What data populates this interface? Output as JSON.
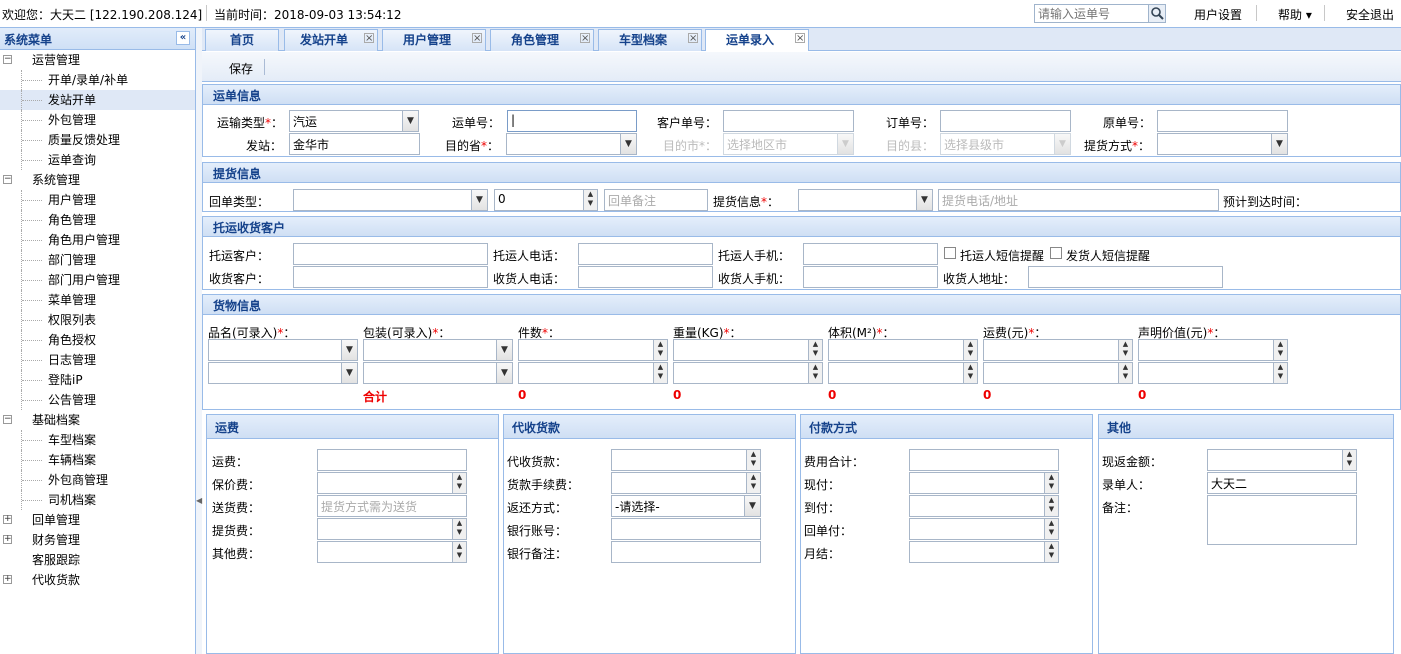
{
  "topbar": {
    "welcome": "欢迎您：大天二 [122.190.208.124]",
    "time": "当前时间：2018-09-03 13:54:12",
    "search_placeholder": "请输入运单号",
    "user_settings": "用户设置",
    "help": "帮助 ▾",
    "logout": "安全退出"
  },
  "sidebar": {
    "title": "系统菜单",
    "collapse_icon": "«",
    "items": [
      {
        "label": "运营管理",
        "level": 1,
        "pm": "⊟"
      },
      {
        "label": "开单/录单/补单",
        "level": 2
      },
      {
        "label": "发站开单",
        "level": 2,
        "selected": true
      },
      {
        "label": "外包管理",
        "level": 2
      },
      {
        "label": "质量反馈处理",
        "level": 2
      },
      {
        "label": "运单查询",
        "level": 2
      },
      {
        "label": "系统管理",
        "level": 1,
        "pm": "⊟"
      },
      {
        "label": "用户管理",
        "level": 2
      },
      {
        "label": "角色管理",
        "level": 2
      },
      {
        "label": "角色用户管理",
        "level": 2
      },
      {
        "label": "部门管理",
        "level": 2
      },
      {
        "label": "部门用户管理",
        "level": 2
      },
      {
        "label": "菜单管理",
        "level": 2
      },
      {
        "label": "权限列表",
        "level": 2
      },
      {
        "label": "角色授权",
        "level": 2
      },
      {
        "label": "日志管理",
        "level": 2
      },
      {
        "label": "登陆iP",
        "level": 2
      },
      {
        "label": "公告管理",
        "level": 2
      },
      {
        "label": "基础档案",
        "level": 1,
        "pm": "⊟"
      },
      {
        "label": "车型档案",
        "level": 2
      },
      {
        "label": "车辆档案",
        "level": 2
      },
      {
        "label": "外包商管理",
        "level": 2
      },
      {
        "label": "司机档案",
        "level": 2
      },
      {
        "label": "回单管理",
        "level": 1,
        "pm": "⊞"
      },
      {
        "label": "财务管理",
        "level": 1,
        "pm": "⊞"
      },
      {
        "label": "客服跟踪",
        "level": 1,
        "pm": ""
      },
      {
        "label": "代收货款",
        "level": 1,
        "pm": "⊞"
      }
    ]
  },
  "tabs": [
    {
      "label": "首页",
      "closable": false
    },
    {
      "label": "发站开单",
      "closable": true
    },
    {
      "label": "用户管理",
      "closable": true
    },
    {
      "label": "角色管理",
      "closable": true
    },
    {
      "label": "车型档案",
      "closable": true
    },
    {
      "label": "运单录入",
      "closable": true,
      "active": true
    }
  ],
  "toolbar": {
    "save": "保存"
  },
  "waybill": {
    "title": "运单信息",
    "transport_type_label": "运输类型",
    "transport_type_value": "汽运",
    "waybill_no_label": "运单号：",
    "customer_no_label": "客户单号：",
    "order_no_label": "订单号：",
    "original_no_label": "原单号：",
    "origin_label": "发站：",
    "origin_value": "金华市",
    "dest_prov_label": "目的省",
    "dest_city_label": "目的市",
    "dest_city_ph": "选择地区市",
    "dest_county_label": "目的县：",
    "dest_county_ph": "选择县级市",
    "pickup_method_label": "提货方式"
  },
  "pickup": {
    "title": "提货信息",
    "return_type_label": "回单类型：",
    "return_count": "0",
    "return_note_ph": "回单备注",
    "pickup_info_label": "提货信息",
    "pickup_contact_ph": "提货电话/地址",
    "eta_label": "预计到达时间："
  },
  "customer": {
    "title": "托运收货客户",
    "shipper_label": "托运客户：",
    "shipper_phone_label": "托运人电话：",
    "shipper_mobile_label": "托运人手机：",
    "shipper_sms": "托运人短信提醒",
    "sender_sms": "发货人短信提醒",
    "consignee_label": "收货客户：",
    "consignee_phone_label": "收货人电话：",
    "consignee_mobile_label": "收货人手机：",
    "consignee_addr_label": "收货人地址："
  },
  "goods": {
    "title": "货物信息",
    "columns": [
      "品名(可录入)",
      "包装(可录入)",
      "件数",
      "重量(KG)",
      "体积(M²)",
      "运费(元)",
      "声明价值(元)"
    ],
    "total_label": "合计",
    "totals": [
      "0",
      "0",
      "0",
      "0",
      "0"
    ]
  },
  "freight": {
    "title": "运费",
    "rows": [
      "运费：",
      "保价费：",
      "送货费：",
      "提货费：",
      "其他费："
    ],
    "delivery_ph": "提货方式需为送货"
  },
  "cod": {
    "title": "代收货款",
    "rows": [
      "代收货款：",
      "货款手续费：",
      "返还方式：",
      "银行账号：",
      "银行备注："
    ],
    "return_select": "-请选择-"
  },
  "payment": {
    "title": "付款方式",
    "rows": [
      "费用合计：",
      "现付：",
      "到付：",
      "回单付：",
      "月结："
    ]
  },
  "other": {
    "title": "其他",
    "rows": [
      "现返金额：",
      "录单人：",
      "备注："
    ],
    "recorder": "大天二"
  }
}
